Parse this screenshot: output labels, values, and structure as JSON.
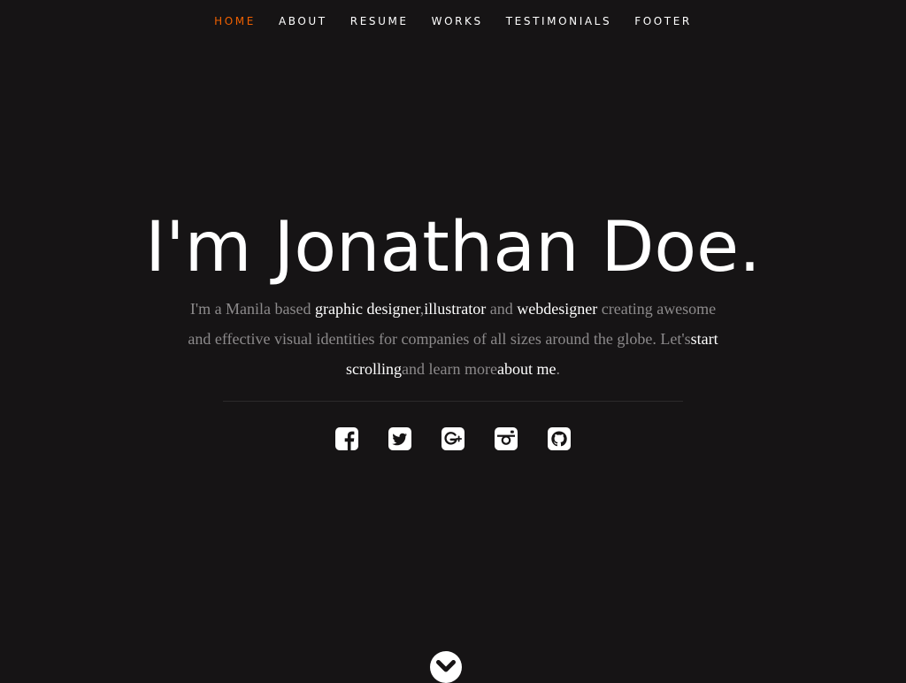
{
  "nav": {
    "items": [
      {
        "label": "HOME",
        "active": true
      },
      {
        "label": "ABOUT",
        "active": false
      },
      {
        "label": "RESUME",
        "active": false
      },
      {
        "label": "WORKS",
        "active": false
      },
      {
        "label": "TESTIMONIALS",
        "active": false
      },
      {
        "label": "FOOTER",
        "active": false
      }
    ],
    "active_color": "#f06000"
  },
  "hero": {
    "headline": "I'm Jonathan Doe.",
    "intro": {
      "t1": "I'm a Manila based ",
      "link_graphic_designer": "graphic designer",
      "t2": ",",
      "link_illustrator": "illustrator",
      "t3": " and ",
      "link_webdesigner": "webdesigner",
      "t4": " creating awesome and effective visual identities for companies of all sizes around the globe. Let's",
      "link_start_scrolling": "start scrolling",
      "t5": "and learn more",
      "link_about_me": "about me",
      "t6": "."
    }
  },
  "social": {
    "icons": [
      "facebook-icon",
      "twitter-icon",
      "google-plus-icon",
      "instagram-icon",
      "github-icon"
    ]
  },
  "scroll_down": {
    "icon": "chevron-down-circle-icon"
  },
  "colors": {
    "background": "#161415",
    "text_muted": "#8c8a8b",
    "text_bright": "#ffffff",
    "accent": "#f06000"
  }
}
